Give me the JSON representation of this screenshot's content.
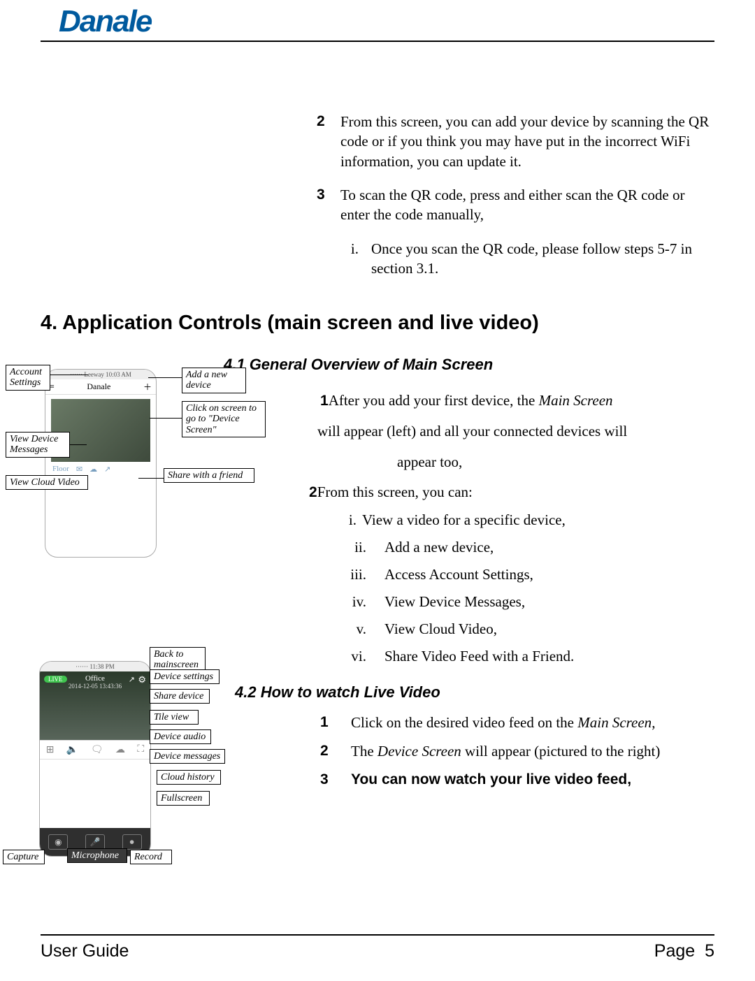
{
  "logo": "Danale",
  "intro": {
    "items": [
      {
        "num": "2",
        "text": "From this screen, you can add your device by scanning the QR code or if you think you may have put in the incorrect WiFi information, you can update it."
      },
      {
        "num": "3",
        "text": "To scan the QR code, press and either scan the QR code or enter the code manually,"
      }
    ],
    "sub": {
      "rom": "i.",
      "text": "Once you scan the QR code, please follow steps 5-7 in section 3.1."
    }
  },
  "section4_heading": "4. Application Controls (main screen and live video)",
  "section41_heading": "4.1 General Overview of Main Screen",
  "overview": {
    "line1_num": "1",
    "line1_a": "After you add your first device, the ",
    "line1_ital": "Main Screen",
    "line1_cont": " will appear (left) and all your connected devices will",
    "line1_cont2": "appear too,",
    "line2_num": "2",
    "line2": "From this screen, you can:"
  },
  "roman_items": [
    {
      "r": "i.",
      "t": "View a video for a specific device,"
    },
    {
      "r": "ii.",
      "t": "Add a new device,"
    },
    {
      "r": "iii.",
      "t": "Access Account Settings,"
    },
    {
      "r": "iv.",
      "t": "View Device Messages,"
    },
    {
      "r": "v.",
      "t": "View Cloud Video,"
    },
    {
      "r": "vi.",
      "t": "Share Video Feed with a Friend."
    }
  ],
  "section42_heading": "4.2 How to watch Live Video",
  "sec42_items": [
    {
      "n": "1",
      "t_a": "Click on the desired video feed on the ",
      "ital": "Main Screen",
      "t_b": ","
    },
    {
      "n": "2",
      "t_a": "The ",
      "ital": "Device Screen",
      "t_b": " will appear (pictured to the right)"
    },
    {
      "n": "3",
      "bold": "You can now watch your live video feed,"
    }
  ],
  "fig1": {
    "app_title": "Danale",
    "status": "······ Leeway   10:03 AM",
    "thumb_label": "Floor",
    "callouts": {
      "account_settings": "Account Settings",
      "add_new": "Add a new device",
      "click_screen": "Click on screen to go to \"Device Screen\"",
      "view_messages": "View Device Messages",
      "view_cloud": "View Cloud Video",
      "share_friend": "Share with a friend"
    }
  },
  "fig2": {
    "live": "LIVE",
    "title": "Office",
    "time": "2014-12-05  13:43:36",
    "callouts": {
      "back": "Back to mainscreen",
      "settings": "Device settings",
      "share": "Share device",
      "tile": "Tile view",
      "audio": "Device audio",
      "messages": "Device messages",
      "cloud": "Cloud history",
      "fullscreen": "Fullscreen",
      "capture": "Capture",
      "microphone": "Microphone",
      "record": "Record"
    }
  },
  "footer": {
    "left": "User Guide",
    "right_label": "Page",
    "right_num": "5"
  }
}
